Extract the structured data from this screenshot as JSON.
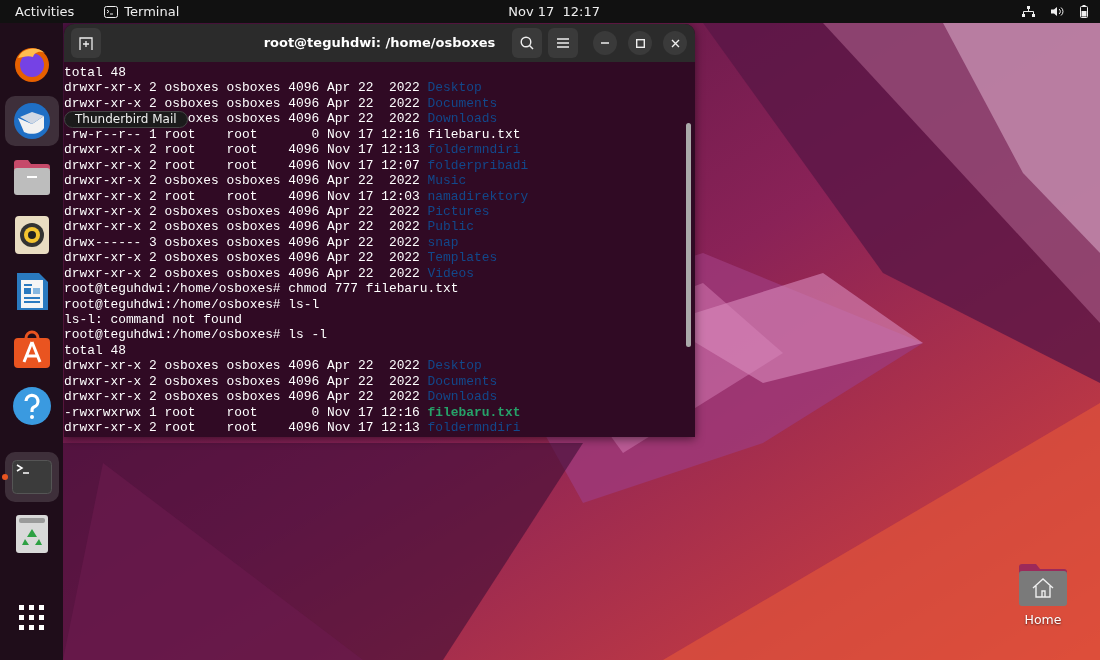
{
  "top_bar": {
    "activities": "Activities",
    "app_name": "Terminal",
    "clock": "Nov 17  12:17"
  },
  "dock": {
    "items": [
      {
        "kind": "browser",
        "running": false,
        "hovered": false
      },
      {
        "kind": "mail",
        "running": false,
        "hovered": true
      },
      {
        "kind": "files",
        "running": false,
        "hovered": false
      },
      {
        "kind": "music",
        "running": false,
        "hovered": false
      },
      {
        "kind": "writer",
        "running": false,
        "hovered": false
      },
      {
        "kind": "store",
        "running": false,
        "hovered": false
      },
      {
        "kind": "help",
        "running": false,
        "hovered": false
      },
      {
        "kind": "terminal",
        "running": true,
        "hovered": false
      },
      {
        "kind": "trash",
        "running": false,
        "hovered": false
      },
      {
        "kind": "apps",
        "running": false,
        "hovered": false
      }
    ],
    "tooltip": "Thunderbird Mail"
  },
  "terminal": {
    "title": "root@teguhdwi: /home/osboxes",
    "lines": [
      {
        "text": "total 48"
      },
      {
        "text": "drwxr-xr-x 2 osboxes osboxes 4096 Apr 22  2022",
        "name": "Desktop",
        "kind": "directory"
      },
      {
        "text": "drwxr-xr-x 2 osboxes osboxes 4096 Apr 22  2022",
        "name": "Documents",
        "kind": "directory"
      },
      {
        "text": "oxes osboxes 4096 Apr 22  2022",
        "name": "Downloads",
        "kind": "directory",
        "under_tooltip": true
      },
      {
        "text": "-rw-r--r-- 1 root    root       0 Nov 17 12:16",
        "name": "filebaru.txt",
        "kind": "file"
      },
      {
        "text": "drwxr-xr-x 2 root    root    4096 Nov 17 12:13",
        "name": "foldermndiri",
        "kind": "directory"
      },
      {
        "text": "drwxr-xr-x 2 root    root    4096 Nov 17 12:07",
        "name": "folderpribadi",
        "kind": "directory"
      },
      {
        "text": "drwxr-xr-x 2 osboxes osboxes 4096 Apr 22  2022",
        "name": "Music",
        "kind": "directory"
      },
      {
        "text": "drwxr-xr-x 2 root    root    4096 Nov 17 12:03",
        "name": "namadirektory",
        "kind": "directory"
      },
      {
        "text": "drwxr-xr-x 2 osboxes osboxes 4096 Apr 22  2022",
        "name": "Pictures",
        "kind": "directory"
      },
      {
        "text": "drwxr-xr-x 2 osboxes osboxes 4096 Apr 22  2022",
        "name": "Public",
        "kind": "directory"
      },
      {
        "text": "drwx------ 3 osboxes osboxes 4096 Apr 22  2022",
        "name": "snap",
        "kind": "directory"
      },
      {
        "text": "drwxr-xr-x 2 osboxes osboxes 4096 Apr 22  2022",
        "name": "Templates",
        "kind": "directory"
      },
      {
        "text": "drwxr-xr-x 2 osboxes osboxes 4096 Apr 22  2022",
        "name": "Videos",
        "kind": "directory"
      },
      {
        "text": "root@teguhdwi:/home/osboxes# chmod 777 filebaru.txt"
      },
      {
        "text": "root@teguhdwi:/home/osboxes# ls-l"
      },
      {
        "text": "ls-l: command not found"
      },
      {
        "text": "root@teguhdwi:/home/osboxes# ls -l"
      },
      {
        "text": "total 48"
      },
      {
        "text": "drwxr-xr-x 2 osboxes osboxes 4096 Apr 22  2022",
        "name": "Desktop",
        "kind": "directory"
      },
      {
        "text": "drwxr-xr-x 2 osboxes osboxes 4096 Apr 22  2022",
        "name": "Documents",
        "kind": "directory"
      },
      {
        "text": "drwxr-xr-x 2 osboxes osboxes 4096 Apr 22  2022",
        "name": "Downloads",
        "kind": "directory"
      },
      {
        "text": "-rwxrwxrwx 1 root    root       0 Nov 17 12:16",
        "name": "filebaru.txt",
        "kind": "executable"
      },
      {
        "text": "drwxr-xr-x 2 root    root    4096 Nov 17 12:13",
        "name": "foldermndiri",
        "kind": "directory"
      }
    ]
  },
  "desktop_icons": [
    {
      "label": "Home"
    }
  ]
}
